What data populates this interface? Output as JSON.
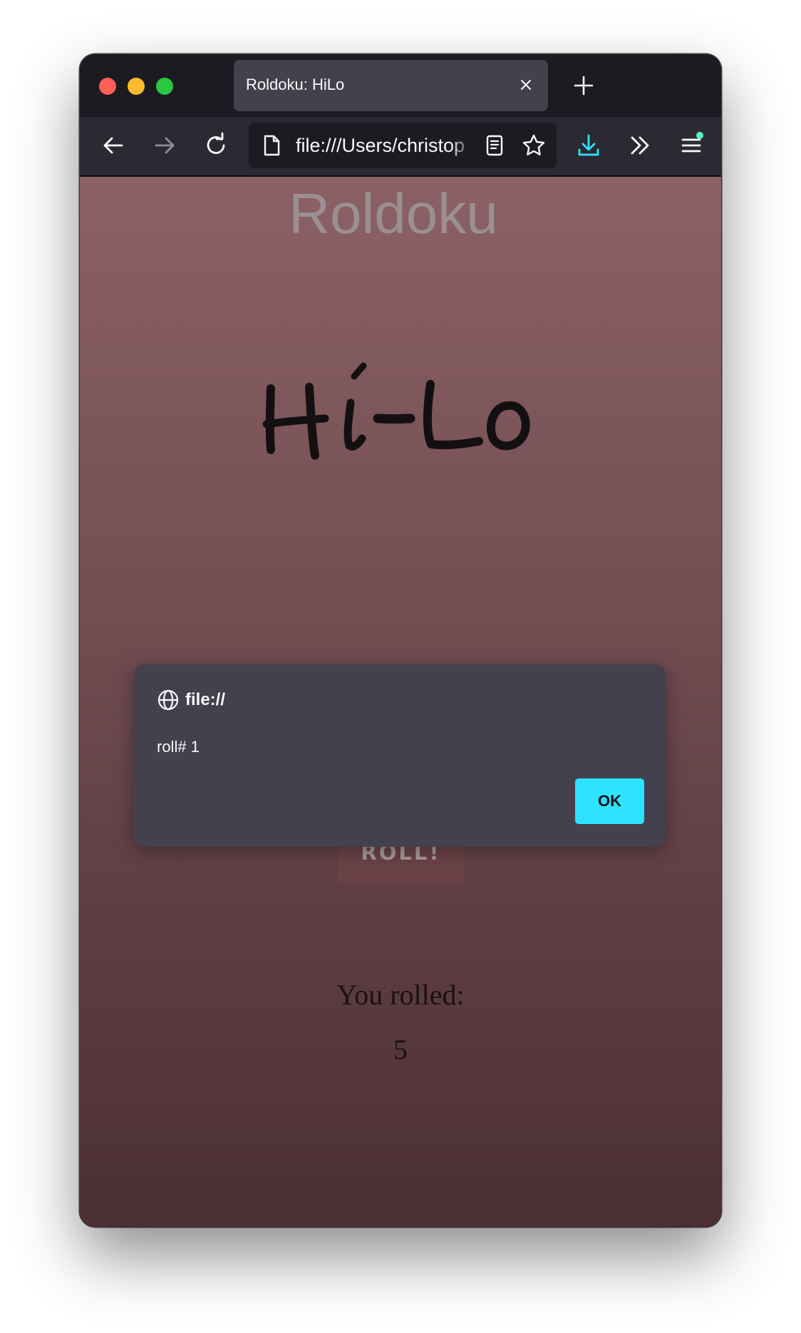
{
  "browser": {
    "tab_title": "Roldoku: HiLo",
    "url": "file:///Users/christop",
    "icons": {
      "back": "arrow-left-icon",
      "forward": "arrow-right-icon",
      "reload": "reload-icon",
      "page": "page-icon",
      "reader": "reader-view-icon",
      "bookmark": "star-icon",
      "downloads": "download-icon",
      "overflow": "chevrons-right-icon",
      "menu": "hamburger-menu-icon"
    },
    "colors": {
      "accent": "#2ee3ff",
      "tab_active": "#42414d",
      "toolbar": "#2b2a33"
    }
  },
  "page": {
    "site_title": "Roldoku",
    "game_title": "Hi-Lo",
    "roll_button": "ROLL!",
    "rolled_label": "You rolled:",
    "rolled_value": "5"
  },
  "dialog": {
    "origin": "file://",
    "message": "roll# 1",
    "ok_label": "OK"
  }
}
